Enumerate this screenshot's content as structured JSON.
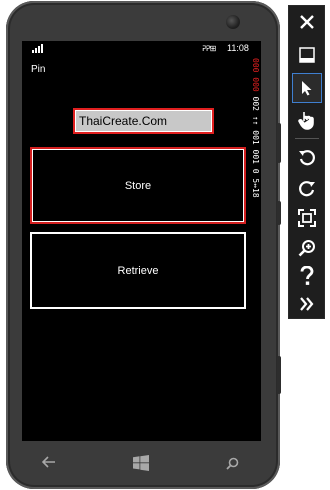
{
  "status_bar": {
    "time": "11:08",
    "icons": "ᕈᕈ⊞"
  },
  "app": {
    "page_label": "Pin",
    "textbox_value": "ThaiCreate.Com",
    "store_button": "Store",
    "retrieve_button": "Retrieve"
  },
  "frame_counters": {
    "red": "000 000",
    "white": "002 ↑↑ 001 001 0 5↔18"
  },
  "nav_bar": {
    "back_icon": "back-arrow-icon",
    "start_icon": "windows-start-icon",
    "search_icon": "search-icon"
  },
  "toolbar": {
    "items": [
      "close-icon",
      "minimize-icon",
      "pointer-icon",
      "touch-icon",
      "rotate-left-icon",
      "rotate-right-icon",
      "fit-screen-icon",
      "zoom-icon",
      "help-icon",
      "expand-icon"
    ],
    "accent_color": "#3f7fd0"
  },
  "colors": {
    "highlight": "#e02020",
    "textbox_bg": "#c8c8c8",
    "screen_bg": "#000000"
  }
}
